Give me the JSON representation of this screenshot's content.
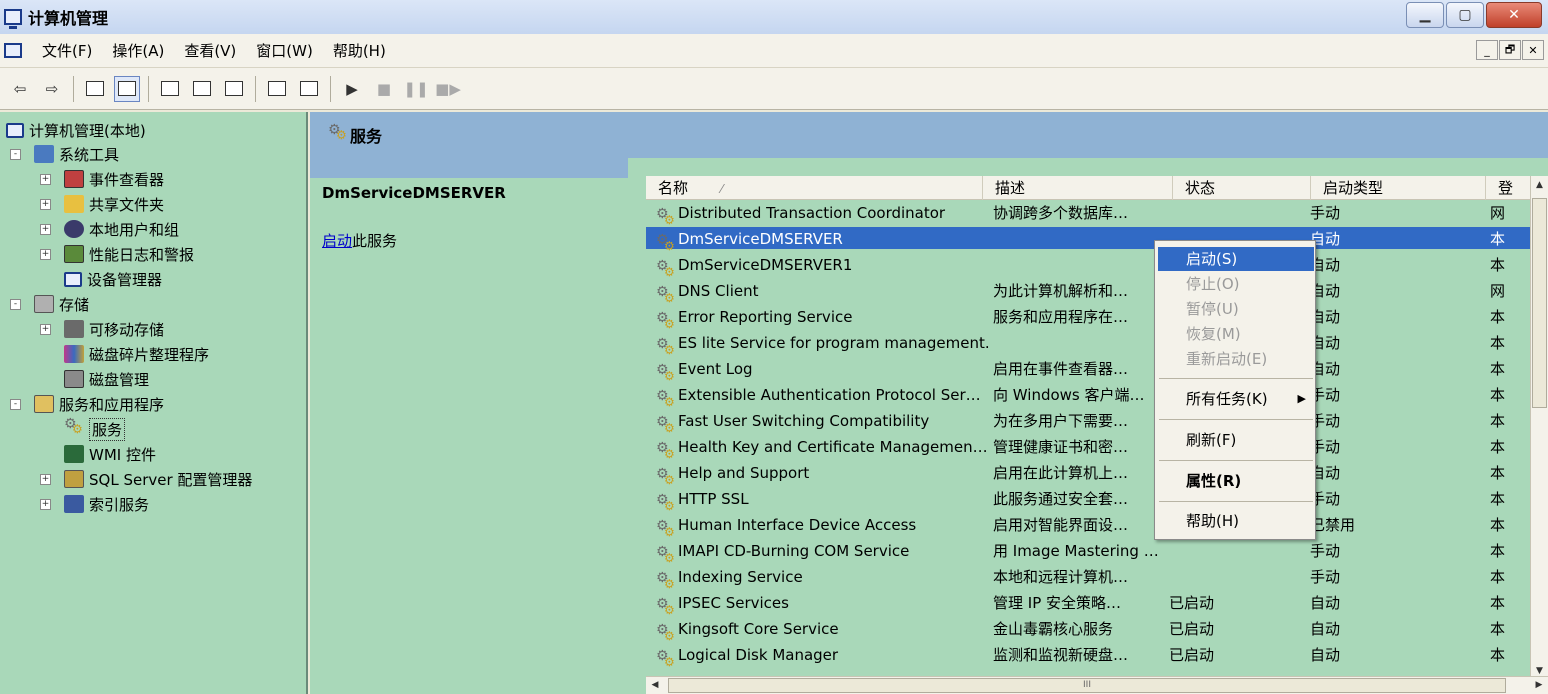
{
  "window": {
    "title": "计算机管理",
    "btn_min": "▁",
    "btn_max": "▢",
    "btn_close": "✕"
  },
  "menubar": {
    "items": [
      "文件(F)",
      "操作(A)",
      "查看(V)",
      "窗口(W)",
      "帮助(H)"
    ],
    "mdi_min": "_",
    "mdi_restore": "🗗",
    "mdi_close": "✕"
  },
  "toolbar": {
    "back": "⇦",
    "forward": "⇨",
    "play": "▶",
    "stop": "■",
    "pause": "❚❚",
    "restart": "■▶"
  },
  "tree": {
    "root": "计算机管理(本地)",
    "items": [
      {
        "label": "系统工具",
        "expander": "-"
      },
      {
        "label": "事件查看器",
        "expander": "+"
      },
      {
        "label": "共享文件夹",
        "expander": "+"
      },
      {
        "label": "本地用户和组",
        "expander": "+"
      },
      {
        "label": "性能日志和警报",
        "expander": "+"
      },
      {
        "label": "设备管理器",
        "expander": ""
      },
      {
        "label": "存储",
        "expander": "-"
      },
      {
        "label": "可移动存储",
        "expander": "+"
      },
      {
        "label": "磁盘碎片整理程序",
        "expander": ""
      },
      {
        "label": "磁盘管理",
        "expander": ""
      },
      {
        "label": "服务和应用程序",
        "expander": "-"
      },
      {
        "label": "服务",
        "expander": ""
      },
      {
        "label": "WMI 控件",
        "expander": ""
      },
      {
        "label": "SQL Server 配置管理器",
        "expander": "+"
      },
      {
        "label": "索引服务",
        "expander": "+"
      }
    ]
  },
  "right": {
    "header_title": "服务",
    "ext_title": "DmServiceDMSERVER",
    "ext_link": "启动",
    "ext_link_suffix": "此服务"
  },
  "list": {
    "columns": [
      "名称",
      "描述",
      "状态",
      "启动类型",
      "登"
    ],
    "sort_glyph": "⁄",
    "rows": [
      {
        "name": "Distributed Transaction Coordinator",
        "desc": "协调跨多个数据库…",
        "status": "",
        "startup": "手动",
        "logon": "网"
      },
      {
        "name": "DmServiceDMSERVER",
        "desc": "",
        "status": "",
        "startup": "自动",
        "logon": "本"
      },
      {
        "name": "DmServiceDMSERVER1",
        "desc": "",
        "status": "",
        "startup": "自动",
        "logon": "本"
      },
      {
        "name": "DNS Client",
        "desc": "为此计算机解析和…",
        "status": "",
        "startup": "自动",
        "logon": "网"
      },
      {
        "name": "Error Reporting Service",
        "desc": "服务和应用程序在…",
        "status": "",
        "startup": "自动",
        "logon": "本"
      },
      {
        "name": "ES lite Service for program management.",
        "desc": "",
        "status": "",
        "startup": "自动",
        "logon": "本"
      },
      {
        "name": "Event Log",
        "desc": "启用在事件查看器…",
        "status": "",
        "startup": "自动",
        "logon": "本"
      },
      {
        "name": "Extensible Authentication Protocol Ser…",
        "desc": "向 Windows 客户端…",
        "status": "",
        "startup": "手动",
        "logon": "本"
      },
      {
        "name": "Fast User Switching Compatibility",
        "desc": "为在多用户下需要…",
        "status": "",
        "startup": "手动",
        "logon": "本"
      },
      {
        "name": "Health Key and Certificate Managemen…",
        "desc": "管理健康证书和密…",
        "status": "",
        "startup": "手动",
        "logon": "本"
      },
      {
        "name": "Help and Support",
        "desc": "启用在此计算机上…",
        "status": "",
        "startup": "自动",
        "logon": "本"
      },
      {
        "name": "HTTP SSL",
        "desc": "此服务通过安全套…",
        "status": "",
        "startup": "手动",
        "logon": "本"
      },
      {
        "name": "Human Interface Device Access",
        "desc": "启用对智能界面设…",
        "status": "",
        "startup": "已禁用",
        "logon": "本"
      },
      {
        "name": "IMAPI CD-Burning COM Service",
        "desc": "用 Image Mastering …",
        "status": "",
        "startup": "手动",
        "logon": "本"
      },
      {
        "name": "Indexing Service",
        "desc": "本地和远程计算机…",
        "status": "",
        "startup": "手动",
        "logon": "本"
      },
      {
        "name": "IPSEC Services",
        "desc": "管理 IP 安全策略…",
        "status": "已启动",
        "startup": "自动",
        "logon": "本"
      },
      {
        "name": "Kingsoft Core Service",
        "desc": "金山毒霸核心服务",
        "status": "已启动",
        "startup": "自动",
        "logon": "本"
      },
      {
        "name": "Logical Disk Manager",
        "desc": "监测和监视新硬盘…",
        "status": "已启动",
        "startup": "自动",
        "logon": "本"
      }
    ],
    "hscroll_grip": "III"
  },
  "context_menu": {
    "start": "启动(S)",
    "stop": "停止(O)",
    "pause": "暂停(U)",
    "resume": "恢复(M)",
    "restart": "重新启动(E)",
    "all_tasks": "所有任务(K)",
    "refresh": "刷新(F)",
    "properties": "属性(R)",
    "help": "帮助(H)",
    "submenu_arrow": "▶"
  },
  "colors": {
    "pane_bg": "#a9d8b9",
    "header_bg": "#8fb2d4",
    "selection": "#316ac5",
    "link": "#0000cc"
  }
}
